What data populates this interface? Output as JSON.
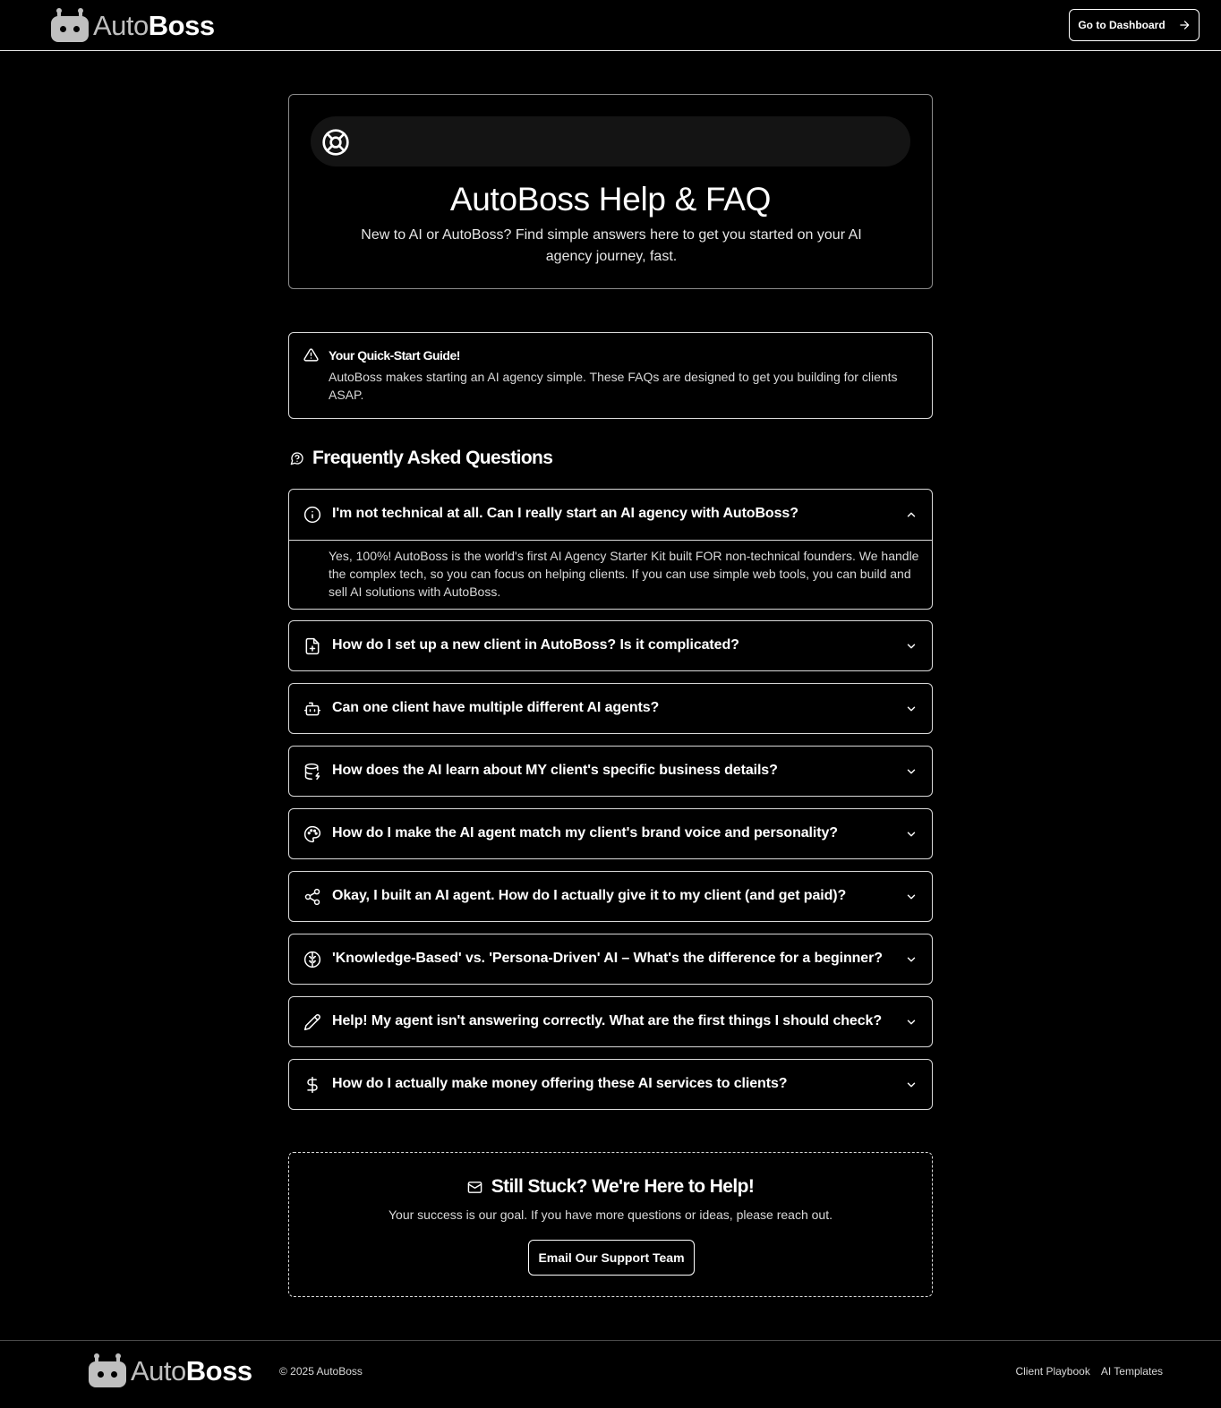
{
  "brand": {
    "name_light": "Auto",
    "name_bold": "Boss"
  },
  "header": {
    "dashboard_button": "Go to Dashboard"
  },
  "hero": {
    "title": "AutoBoss Help & FAQ",
    "subtitle": "New to AI or AutoBoss? Find simple answers here to get you started on your AI agency journey, fast."
  },
  "quickstart": {
    "title": "Your Quick-Start Guide!",
    "text": "AutoBoss makes starting an AI agency simple. These FAQs are designed to get you building for clients ASAP."
  },
  "faq": {
    "heading": "Frequently Asked Questions",
    "items": [
      {
        "icon": "info-circle-icon",
        "question": "I'm not technical at all. Can I really start an AI agency with AutoBoss?",
        "expanded": true,
        "answer": "Yes, 100%! AutoBoss is the world's first AI Agency Starter Kit built FOR non-technical founders. We handle the complex tech, so you can focus on helping clients. If you can use simple web tools, you can build and sell AI solutions with AutoBoss."
      },
      {
        "icon": "file-plus-icon",
        "question": "How do I set up a new client in AutoBoss? Is it complicated?",
        "expanded": false
      },
      {
        "icon": "bot-icon",
        "question": "Can one client have multiple different AI agents?",
        "expanded": false
      },
      {
        "icon": "database-icon",
        "question": "How does the AI learn about MY client's specific business details?",
        "expanded": false
      },
      {
        "icon": "palette-icon",
        "question": "How do I make the AI agent match my client's brand voice and personality?",
        "expanded": false
      },
      {
        "icon": "share-icon",
        "question": "Okay, I built an AI agent. How do I actually give it to my client (and get paid)?",
        "expanded": false
      },
      {
        "icon": "brain-icon",
        "question": "'Knowledge-Based' vs. 'Persona-Driven' AI – What's the difference for a beginner?",
        "expanded": false
      },
      {
        "icon": "pencil-icon",
        "question": "Help! My agent isn't answering correctly. What are the first things I should check?",
        "expanded": false
      },
      {
        "icon": "dollar-icon",
        "question": "How do I actually make money offering these AI services to clients?",
        "expanded": false
      }
    ]
  },
  "support": {
    "title": "Still Stuck? We're Here to Help!",
    "text": "Your success is our goal. If you have more questions or ideas, please reach out.",
    "button": "Email Our Support Team"
  },
  "footer": {
    "copyright": "© 2025 AutoBoss",
    "links": [
      "Client Playbook",
      "AI Templates"
    ]
  }
}
